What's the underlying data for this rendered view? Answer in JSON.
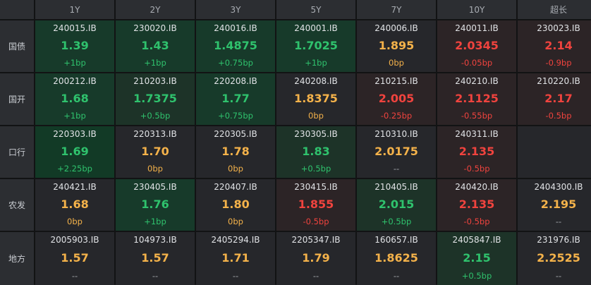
{
  "columns": [
    "1Y",
    "2Y",
    "3Y",
    "5Y",
    "7Y",
    "10Y",
    "超长"
  ],
  "rows": [
    {
      "label": "国债",
      "cells": [
        {
          "code": "240015.IB",
          "yield": "1.39",
          "change": "+1bp",
          "tone": "g",
          "bg": "up"
        },
        {
          "code": "230020.IB",
          "yield": "1.43",
          "change": "+1bp",
          "tone": "g",
          "bg": "up"
        },
        {
          "code": "240016.IB",
          "yield": "1.4875",
          "change": "+0.75bp",
          "tone": "g",
          "bg": "up"
        },
        {
          "code": "240001.IB",
          "yield": "1.7025",
          "change": "+1bp",
          "tone": "g",
          "bg": "up"
        },
        {
          "code": "240006.IB",
          "yield": "1.895",
          "change": "0bp",
          "tone": "o",
          "bg": ""
        },
        {
          "code": "240011.IB",
          "yield": "2.0345",
          "change": "-0.05bp",
          "tone": "r",
          "bg": "dn"
        },
        {
          "code": "230023.IB",
          "yield": "2.14",
          "change": "-0.9bp",
          "tone": "r",
          "bg": "dn"
        }
      ]
    },
    {
      "label": "国开",
      "cells": [
        {
          "code": "200212.IB",
          "yield": "1.68",
          "change": "+1bp",
          "tone": "g",
          "bg": "up"
        },
        {
          "code": "210203.IB",
          "yield": "1.7375",
          "change": "+0.5bp",
          "tone": "g",
          "bg": "up1"
        },
        {
          "code": "220208.IB",
          "yield": "1.77",
          "change": "+0.75bp",
          "tone": "g",
          "bg": "up"
        },
        {
          "code": "240208.IB",
          "yield": "1.8375",
          "change": "0bp",
          "tone": "o",
          "bg": ""
        },
        {
          "code": "210215.IB",
          "yield": "2.005",
          "change": "-0.25bp",
          "tone": "r",
          "bg": "dn"
        },
        {
          "code": "240210.IB",
          "yield": "2.1125",
          "change": "-0.55bp",
          "tone": "r",
          "bg": "dn"
        },
        {
          "code": "210220.IB",
          "yield": "2.17",
          "change": "-0.5bp",
          "tone": "r",
          "bg": "dn"
        }
      ]
    },
    {
      "label": "口行",
      "cells": [
        {
          "code": "220303.IB",
          "yield": "1.69",
          "change": "+2.25bp",
          "tone": "g",
          "bg": "up2"
        },
        {
          "code": "220313.IB",
          "yield": "1.70",
          "change": "0bp",
          "tone": "o",
          "bg": ""
        },
        {
          "code": "220305.IB",
          "yield": "1.78",
          "change": "0bp",
          "tone": "o",
          "bg": ""
        },
        {
          "code": "230305.IB",
          "yield": "1.83",
          "change": "+0.5bp",
          "tone": "g",
          "bg": "up1"
        },
        {
          "code": "210310.IB",
          "yield": "2.0175",
          "change": "--",
          "tone": "o",
          "bg": ""
        },
        {
          "code": "240311.IB",
          "yield": "2.135",
          "change": "-0.5bp",
          "tone": "r",
          "bg": "dn"
        },
        {
          "code": "",
          "yield": "",
          "change": "",
          "tone": "n",
          "bg": "empty"
        }
      ]
    },
    {
      "label": "农发",
      "cells": [
        {
          "code": "240421.IB",
          "yield": "1.68",
          "change": "0bp",
          "tone": "o",
          "bg": ""
        },
        {
          "code": "230405.IB",
          "yield": "1.76",
          "change": "+1bp",
          "tone": "g",
          "bg": "up"
        },
        {
          "code": "220407.IB",
          "yield": "1.80",
          "change": "0bp",
          "tone": "o",
          "bg": ""
        },
        {
          "code": "230415.IB",
          "yield": "1.855",
          "change": "-0.5bp",
          "tone": "r",
          "bg": "dn"
        },
        {
          "code": "210405.IB",
          "yield": "2.015",
          "change": "+0.5bp",
          "tone": "g",
          "bg": "up1"
        },
        {
          "code": "240420.IB",
          "yield": "2.135",
          "change": "-0.5bp",
          "tone": "r",
          "bg": "dn"
        },
        {
          "code": "2404300.IB",
          "yield": "2.195",
          "change": "--",
          "tone": "o",
          "bg": ""
        }
      ]
    },
    {
      "label": "地方",
      "cells": [
        {
          "code": "2005903.IB",
          "yield": "1.57",
          "change": "--",
          "tone": "o",
          "bg": ""
        },
        {
          "code": "104973.IB",
          "yield": "1.57",
          "change": "--",
          "tone": "o",
          "bg": ""
        },
        {
          "code": "2405294.IB",
          "yield": "1.71",
          "change": "--",
          "tone": "o",
          "bg": ""
        },
        {
          "code": "2205347.IB",
          "yield": "1.79",
          "change": "--",
          "tone": "o",
          "bg": ""
        },
        {
          "code": "160657.IB",
          "yield": "1.8625",
          "change": "--",
          "tone": "o",
          "bg": ""
        },
        {
          "code": "2405847.IB",
          "yield": "2.15",
          "change": "+0.5bp",
          "tone": "g",
          "bg": "up1"
        },
        {
          "code": "231976.IB",
          "yield": "2.2525",
          "change": "--",
          "tone": "o",
          "bg": ""
        }
      ]
    }
  ]
}
